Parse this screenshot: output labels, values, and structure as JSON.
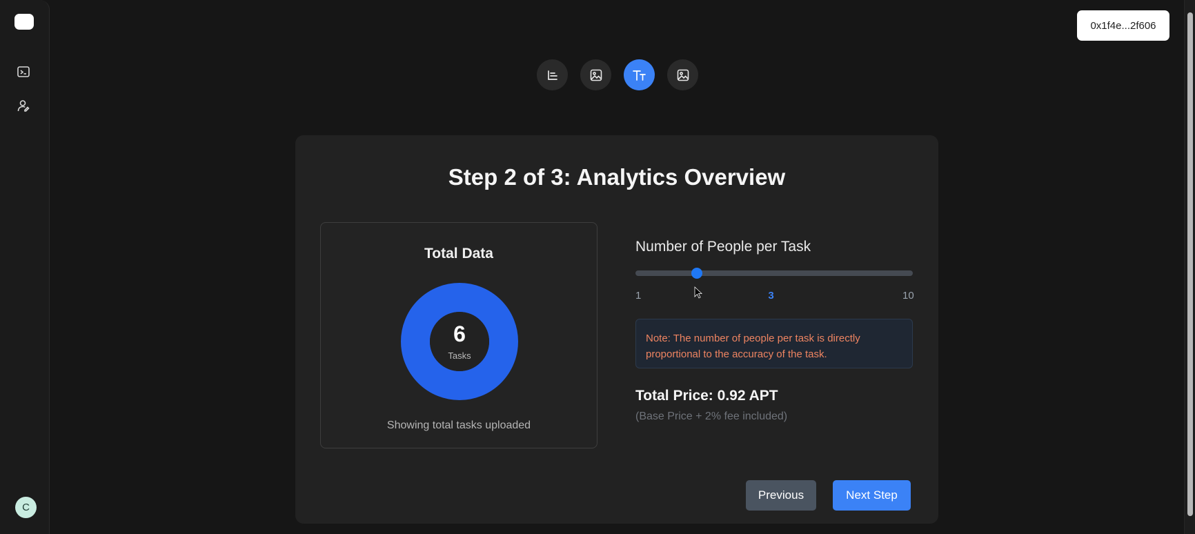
{
  "wallet": {
    "address": "0x1f4e...2f606"
  },
  "user": {
    "avatar_initial": "C"
  },
  "sidebar": {
    "items": [
      {
        "icon": "terminal-icon"
      },
      {
        "icon": "user-edit-icon"
      }
    ]
  },
  "steps": {
    "buttons": [
      {
        "icon": "text-align-icon",
        "active": false
      },
      {
        "icon": "image-icon",
        "active": false
      },
      {
        "icon": "text-type-icon",
        "active": true
      },
      {
        "icon": "image-icon",
        "active": false
      }
    ]
  },
  "card": {
    "title": "Step 2 of 3: Analytics Overview",
    "data_box": {
      "title": "Total Data",
      "value": "6",
      "unit": "Tasks",
      "caption": "Showing total tasks uploaded"
    },
    "slider": {
      "label": "Number of People per Task",
      "min": 1,
      "max": 10,
      "value": 3,
      "min_label": "1",
      "max_label": "10",
      "value_label": "3"
    },
    "note": "Note: The number of people per task is directly proportional to the accuracy of the task.",
    "price": "Total Price: 0.92 APT",
    "price_note": "(Base Price + 2% fee included)",
    "buttons": {
      "previous": "Previous",
      "next": "Next Step"
    }
  },
  "colors": {
    "accent": "#3b82f6",
    "donut": "#2563eb",
    "note_text": "#ee8461"
  }
}
